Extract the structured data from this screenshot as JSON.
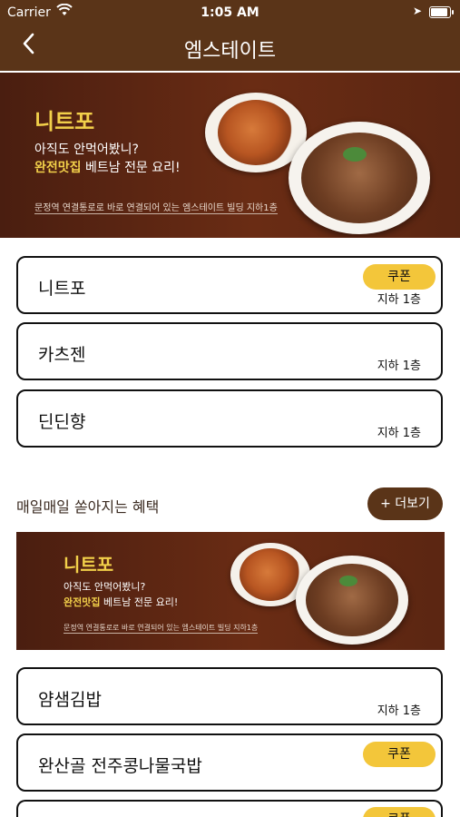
{
  "status_bar": {
    "carrier": "Carrier",
    "time": "1:05 AM"
  },
  "nav": {
    "back_icon": "chevron-left-icon",
    "title": "엠스테이트"
  },
  "banner": {
    "brand": "니트포",
    "line1": "아직도 안먹어봤니?",
    "line2_highlight": "완전맛집",
    "line2_rest": " 베트남 전문 요리!",
    "note": "문정역 연결통로로 바로 연결되어 있는 엠스테이트 빌딩 지하1층"
  },
  "stores": [
    {
      "name": "니트포",
      "floor": "지하 1층",
      "coupon": "쿠폰"
    },
    {
      "name": "카츠젠",
      "floor": "지하 1층"
    },
    {
      "name": "딘딘향",
      "floor": "지하 1층"
    }
  ],
  "section": {
    "title": "매일매일 쏟아지는 혜택",
    "more_label": "+ 더보기"
  },
  "stores2": [
    {
      "name": "얌샘김밥",
      "floor": "지하 1층"
    },
    {
      "name": "완산골 전주콩나물국밥",
      "coupon": "쿠폰"
    },
    {
      "name": "",
      "coupon": "쿠폰"
    }
  ],
  "colors": {
    "brown": "#5a3418",
    "coupon_yellow": "#f3c63a"
  }
}
